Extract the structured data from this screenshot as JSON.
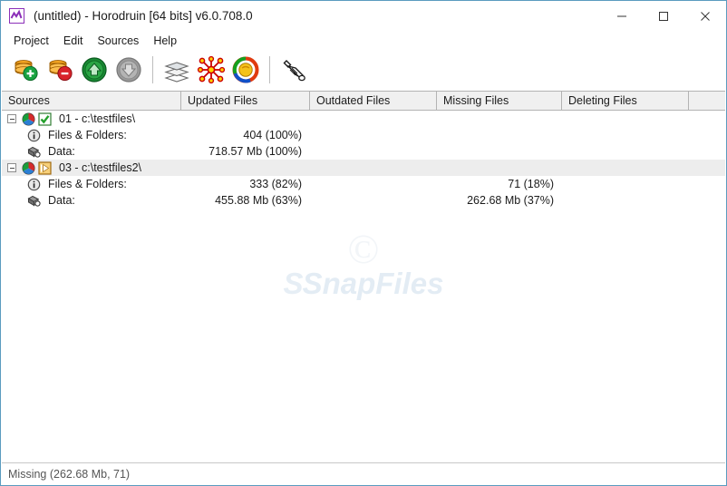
{
  "window": {
    "title": "(untitled) - Horodruin [64 bits] v6.0.708.0",
    "app_icon": "chart-zigzag-icon",
    "border_color": "#5a9bbf",
    "controls": {
      "minimize": "minimize-icon",
      "maximize": "maximize-icon",
      "close": "close-icon"
    }
  },
  "menubar": {
    "items": [
      {
        "label": "Project"
      },
      {
        "label": "Edit"
      },
      {
        "label": "Sources"
      },
      {
        "label": "Help"
      }
    ]
  },
  "toolbar": {
    "buttons": [
      {
        "name": "add-source-button",
        "icon": "coins-plus-icon",
        "enabled": true
      },
      {
        "name": "remove-source-button",
        "icon": "coins-minus-icon",
        "enabled": true
      },
      {
        "name": "move-up-button",
        "icon": "green-up-arrow-icon",
        "enabled": true
      },
      {
        "name": "move-down-button",
        "icon": "grey-down-arrow-icon",
        "enabled": false
      },
      {
        "name": "layers-button",
        "icon": "layers-stack-icon",
        "enabled": true
      },
      {
        "name": "network-button",
        "icon": "red-network-nodes-icon",
        "enabled": true
      },
      {
        "name": "synchronize-button",
        "icon": "color-refresh-circle-icon",
        "enabled": true
      },
      {
        "name": "clean-button",
        "icon": "broom-icon",
        "enabled": true
      }
    ]
  },
  "listview": {
    "columns": [
      {
        "label": "Sources"
      },
      {
        "label": "Updated Files"
      },
      {
        "label": "Outdated Files"
      },
      {
        "label": "Missing Files"
      },
      {
        "label": "Deleting Files"
      },
      {
        "label": ""
      }
    ],
    "rows": [
      {
        "type": "source",
        "icons": [
          "pie-chart-icon",
          "green-check-badge-icon"
        ],
        "label": "01 -  c:\\testfiles\\",
        "updated": "",
        "outdated": "",
        "missing": "",
        "deleting": "",
        "highlight": false
      },
      {
        "type": "child",
        "icon": "info-circle-icon",
        "label": "Files & Folders:",
        "updated": "404 (100%)",
        "outdated": "",
        "missing": "",
        "deleting": "",
        "highlight": false
      },
      {
        "type": "child",
        "icon": "data-disk-icon",
        "label": "Data:",
        "updated": "718.57 Mb (100%)",
        "outdated": "",
        "missing": "",
        "deleting": "",
        "highlight": false
      },
      {
        "type": "source",
        "icons": [
          "pie-chart-icon",
          "orange-play-badge-icon"
        ],
        "label": "03 -  c:\\testfiles2\\",
        "updated": "",
        "outdated": "",
        "missing": "",
        "deleting": "",
        "highlight": true
      },
      {
        "type": "child",
        "icon": "info-circle-icon",
        "label": "Files & Folders:",
        "updated": "333 (82%)",
        "outdated": "",
        "missing": "71 (18%)",
        "deleting": "",
        "highlight": false
      },
      {
        "type": "child",
        "icon": "data-disk-icon",
        "label": "Data:",
        "updated": "455.88 Mb (63%)",
        "outdated": "",
        "missing": "262.68 Mb (37%)",
        "deleting": "",
        "highlight": false
      }
    ]
  },
  "watermark": {
    "copyright": "©",
    "logo": "S",
    "text": "SnapFiles"
  },
  "statusbar": {
    "text": "Missing (262.68 Mb, 71)"
  }
}
